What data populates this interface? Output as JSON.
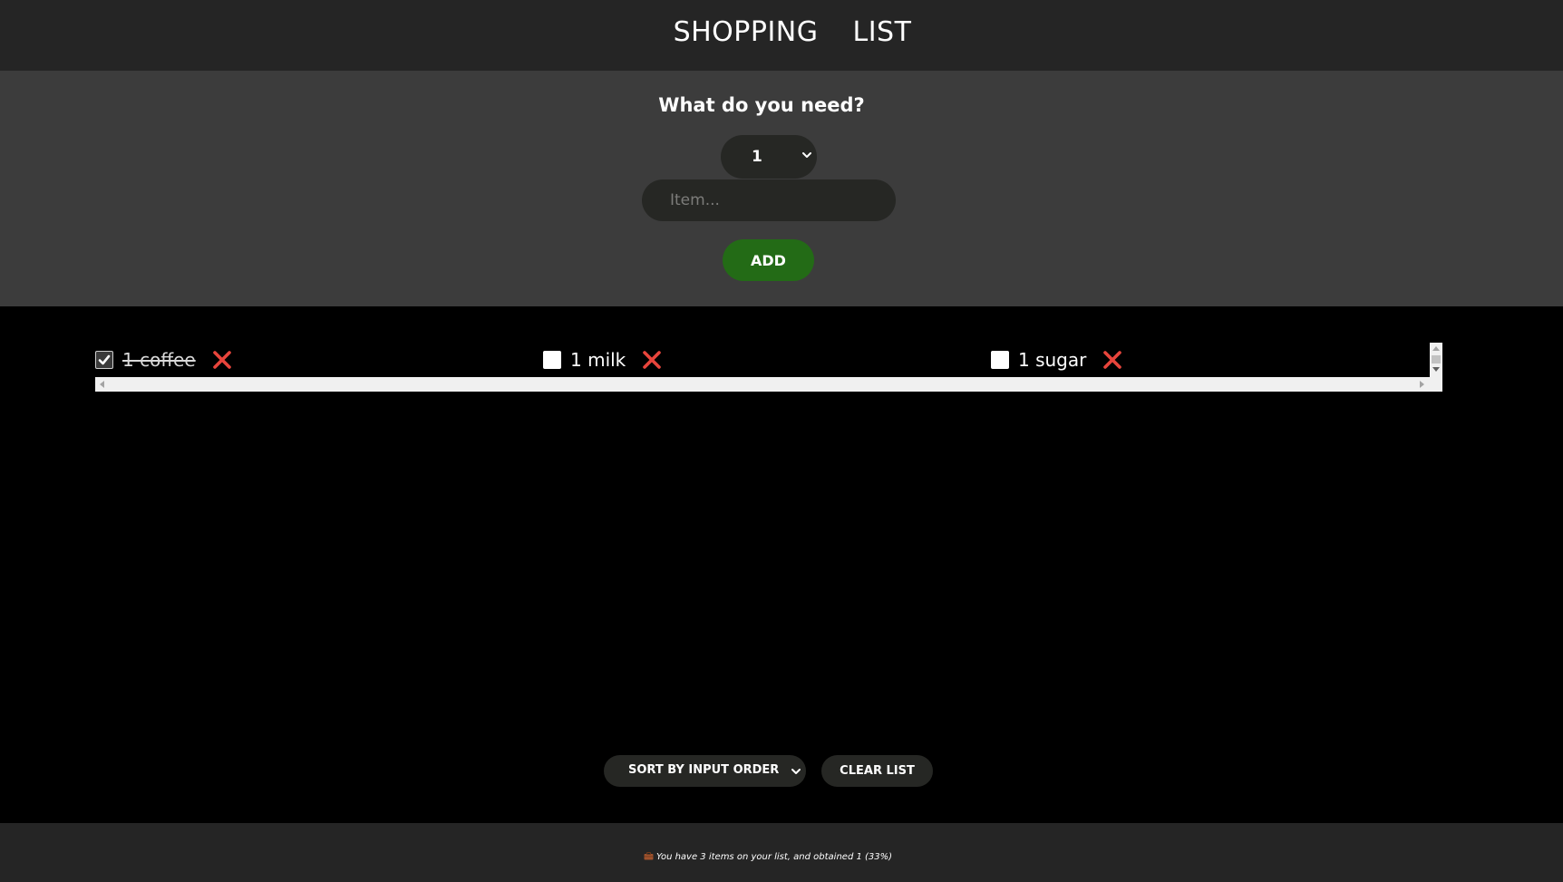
{
  "header": {
    "title_word_1": "SHOPPING",
    "title_word_2": "LIST"
  },
  "form": {
    "prompt": "What do you need?",
    "quantity_value": "1",
    "item_placeholder": "Item...",
    "item_value": "",
    "add_label": "ADD"
  },
  "list": {
    "items": [
      {
        "quantity": "1",
        "name": "coffee",
        "label": "1 coffee",
        "checked": true
      },
      {
        "quantity": "1",
        "name": "milk",
        "label": "1 milk",
        "checked": false
      },
      {
        "quantity": "1",
        "name": "sugar",
        "label": "1 sugar",
        "checked": false
      }
    ]
  },
  "controls": {
    "sort_value": "SORT BY INPUT ORDER",
    "clear_label": "CLEAR LIST"
  },
  "footer": {
    "icon": "briefcase-icon",
    "summary": "You have 3 items on your list, and obtained 1 (33%)"
  },
  "colors": {
    "header_bg": "#252525",
    "form_bg": "#3c3c3c",
    "field_bg": "#262724",
    "add_button": "#236b16",
    "delete_icon": "#e8453c",
    "page_bg": "#000000"
  }
}
